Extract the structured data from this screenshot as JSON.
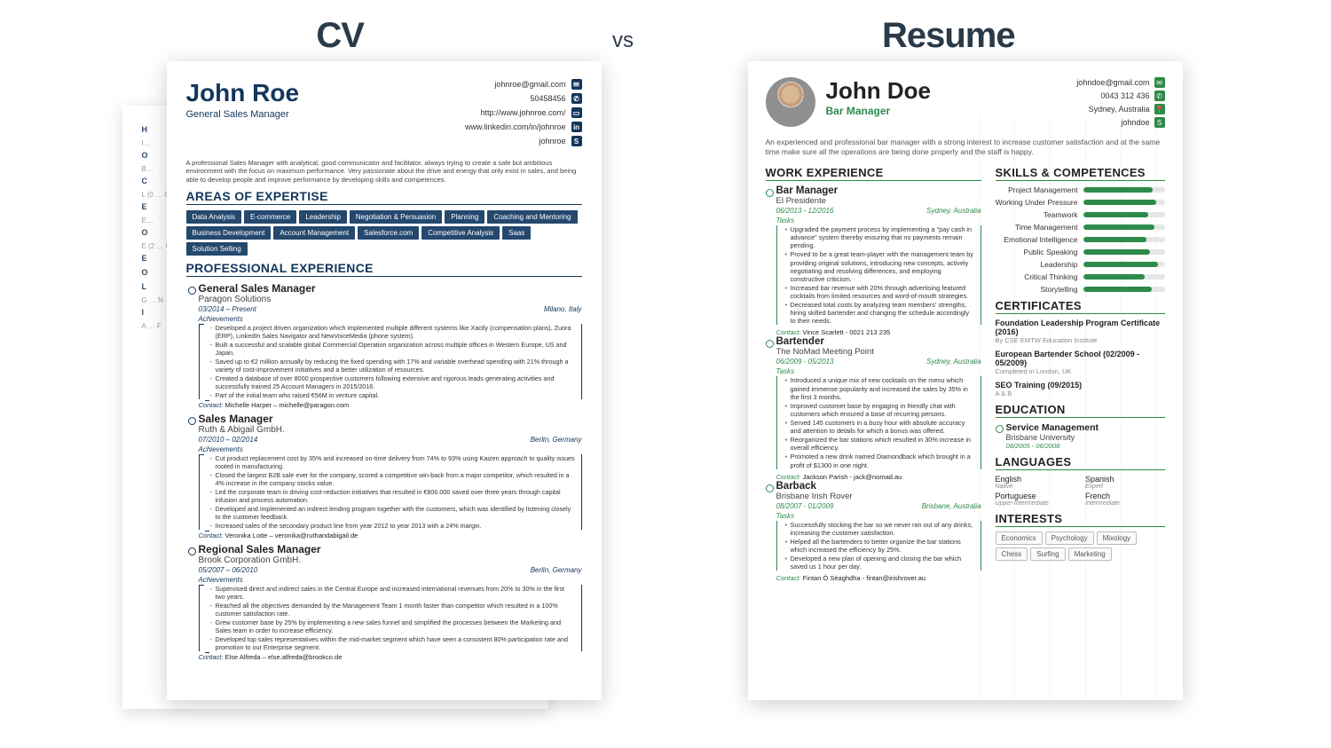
{
  "heading": {
    "left": "CV",
    "vs": "vs",
    "right": "Resume"
  },
  "cv": {
    "name": "John Roe",
    "title": "General Sales Manager",
    "contacts": {
      "email": "johnroe@gmail.com",
      "phone": "50458456",
      "web": "http://www.johnroe.com/",
      "linkedin": "www.linkedin.com/in/johnroe",
      "skype": "johnroe"
    },
    "summary": "A professional Sales Manager with analytical, good communicator and facilitator, always trying to create a safe but ambitious environment with the focus on maximum performance. Very passionate about the drive and energy that only exist in sales, and being able to develop people and improve performance by developing skills and competences.",
    "areas_heading": "AREAS OF EXPERTISE",
    "areas": [
      "Data Analysis",
      "E-commerce",
      "Leadership",
      "Negotiation & Persuasion",
      "Planning",
      "Coaching and Mentoring",
      "Business Development",
      "Account Management",
      "Salesforce.com",
      "Competitive Analysis",
      "Saas",
      "Solution Selling"
    ],
    "exp_heading": "PROFESSIONAL EXPERIENCE",
    "jobs": [
      {
        "title": "General Sales Manager",
        "company": "Paragon Solutions",
        "dates": "03/2014 – Present",
        "location": "Milano, Italy",
        "ach_label": "Achievements",
        "bullets": [
          "Developed a project driven organization which implemented multiple different systems like Xactly (compensation plans), Zuora (ERP), LinkedIn Sales Navigator and NewVoiceMedia (phone system).",
          "Built a successful and scalable global Commercial Operation organization across multiple offices in Western Europe, US and Japan.",
          "Saved up to €2 million annually by reducing the fixed spending with 17% and variable overhead spending with 21% through a variety of cost-improvement initiatives and a better utilization of resources.",
          "Created a database of over 8000 prospective customers following extensive and rigorous leads generating activities and successfully trained 25 Account Managers in 2015/2016.",
          "Part of the initial team who raised €56M in venture capital."
        ],
        "contact": "Michelle Harper – michelle@paragon.com"
      },
      {
        "title": "Sales Manager",
        "company": "Ruth & Abigail GmbH.",
        "dates": "07/2010 – 02/2014",
        "location": "Berlin, Germany",
        "ach_label": "Achievements",
        "bullets": [
          "Cut product replacement cost by 35% and increased on-time delivery from 74% to 93% using Kaizen approach to quality issues rooted in manufacturing.",
          "Closed the largest B2B sale ever for the company, scored a competitive win-back from a major competitor, which resulted in a 4% increase in the company stocks value.",
          "Led the corporate team in driving cost-reduction initiatives that resulted in €800.000 saved over three years through capital infusion and process automation.",
          "Developed and implemented an indirect lending program together with the customers, which was identified by listening closely to the customer feedback.",
          "Increased sales of the secondary product line from year 2012 to year 2013 with a 24% margin."
        ],
        "contact": "Veronika Lotte – veronika@ruthandabigail.de"
      },
      {
        "title": "Regional Sales Manager",
        "company": "Brook Corporation GmbH.",
        "dates": "05/2007 – 06/2010",
        "location": "Berlin, Germany",
        "ach_label": "Achievements",
        "bullets": [
          "Supervised direct and indirect sales in the Central Europe and increased international revenues from 20% to 30% in the first two years.",
          "Reached all the objectives demanded by the Management Team 1 month faster than competitor which resulted in a 100% customer satisfaction rate.",
          "Grew customer base by 25% by implementing a new sales funnel and simplified the processes between the Marketing and Sales team in order to increase efficiency.",
          "Developed top sales representatives within the mid-market segment which have seen a consistent 80% participation rate and promotion to our Enterprise segment."
        ],
        "contact": "Else Alfreda – else.alfreda@brookco.de"
      }
    ],
    "contact_label": "Contact:"
  },
  "resume": {
    "name": "John Doe",
    "title": "Bar Manager",
    "contacts": {
      "email": "johndoe@gmail.com",
      "phone": "0043 312 436",
      "location": "Sydney, Australia",
      "skype": "johndoe"
    },
    "summary": "An experienced and professional bar manager with a strong interest to increase customer satisfaction and at the same time make sure all the operations are being done properly and the staff is happy.",
    "work_heading": "WORK EXPERIENCE",
    "jobs": [
      {
        "title": "Bar Manager",
        "company": "El Presidente",
        "dates": "06/2013 - 12/2016",
        "location": "Sydney, Australia",
        "tasks_label": "Tasks",
        "bullets": [
          "Upgraded the payment process by implementing a \"pay cash in advance\" system thereby ensuring that no payments remain pending.",
          "Proved to be a great team-player with the management team by providing original solutions, introducing new concepts, actively negotiating and resolving differences, and employing constructive criticism.",
          "Increased bar revenue with 20% through advertising featured cocktails from limited resources and word-of-mouth strategies.",
          "Decreased total costs by analyzing team members' strengths, hiring skilled bartender and changing the schedule accordingly to their needs."
        ],
        "contact": "Vince Scarlett - 0021 213 235"
      },
      {
        "title": "Bartender",
        "company": "The NoMad Meeting Point",
        "dates": "06/2009 - 05/2013",
        "location": "Sydney, Australia",
        "tasks_label": "Tasks",
        "bullets": [
          "Introduced a unique mix of new cocktails on the menu which gained immense popularity and increased the sales by 35% in the first 3 months.",
          "Improved customer base by engaging in friendly chat with customers which ensured a base of recurring persons.",
          "Served 145 customers in a busy hour with absolute accuracy and attention to details for which a bonus was offered.",
          "Reorganized the bar stations which resulted in 30% increase in overall efficiency.",
          "Promoted a new drink named Diamondback which brought in a profit of $1300 in one night."
        ],
        "contact": "Jackson Parish - jack@nomad.au"
      },
      {
        "title": "Barback",
        "company": "Brisbane Irish Rover",
        "dates": "08/2007 - 01/2009",
        "location": "Brisbane, Australia",
        "tasks_label": "Tasks",
        "bullets": [
          "Successfully stocking the bar so we never ran out of any drinks, increasing the customer satisfaction.",
          "Helped all the bartenders to better organize the bar stations which increased the efficiency by 25%.",
          "Developed a new plan of opening and closing the bar which saved us 1 hour per day."
        ],
        "contact": "Fintan Ó Séaghdha - fintan@irishrover.au"
      }
    ],
    "contact_label": "Contact:",
    "skills_heading": "SKILLS & COMPETENCES",
    "skills": [
      {
        "name": "Project Management",
        "pct": 85
      },
      {
        "name": "Working Under Pressure",
        "pct": 90
      },
      {
        "name": "Teamwork",
        "pct": 80
      },
      {
        "name": "Time Management",
        "pct": 88
      },
      {
        "name": "Emotional Intelligence",
        "pct": 78
      },
      {
        "name": "Public Speaking",
        "pct": 82
      },
      {
        "name": "Leadership",
        "pct": 92
      },
      {
        "name": "Critical Thinking",
        "pct": 76
      },
      {
        "name": "Storytelling",
        "pct": 84
      }
    ],
    "cert_heading": "CERTIFICATES",
    "certs": [
      {
        "title": "Foundation Leadership Program Certificate (2016)",
        "sub": "By CSE EMTW Education Institute"
      },
      {
        "title": "European Bartender School (02/2009 - 05/2009)",
        "sub": "Completed in London, UK"
      },
      {
        "title": "SEO Training (09/2015)",
        "sub": "A & B"
      }
    ],
    "edu_heading": "EDUCATION",
    "edu": {
      "title": "Service Management",
      "school": "Brisbane University",
      "dates": "08/2005 - 06/2008"
    },
    "lang_heading": "LANGUAGES",
    "languages": [
      {
        "name": "English",
        "level": "Native"
      },
      {
        "name": "Spanish",
        "level": "Expert"
      },
      {
        "name": "Portuguese",
        "level": "Upper-Intermediate"
      },
      {
        "name": "French",
        "level": "Intermediate"
      }
    ],
    "int_heading": "INTERESTS",
    "interests": [
      "Economics",
      "Psychology",
      "Mixology",
      "Chess",
      "Surfing",
      "Marketing"
    ]
  }
}
